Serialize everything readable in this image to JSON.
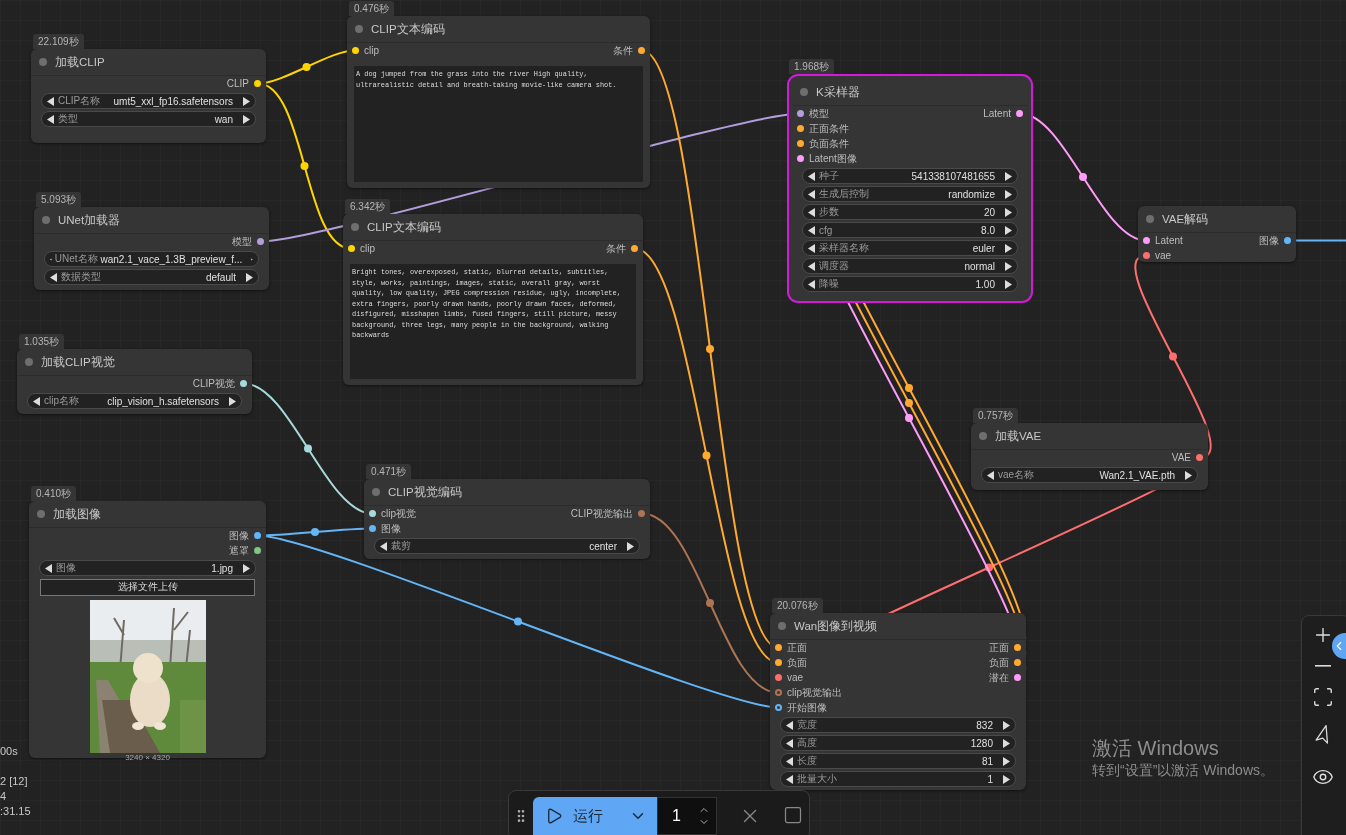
{
  "nodes": [
    {
      "title": "加载CLIP",
      "time": "22.109秒",
      "selected": false,
      "outputs": [
        {
          "label": "CLIP",
          "color": "#ffd500"
        }
      ],
      "widgets": [
        {
          "label": "CLIP名称",
          "value": "umt5_xxl_fp16.safetensors"
        },
        {
          "label": "类型",
          "value": "wan"
        }
      ]
    },
    {
      "title": "UNet加载器",
      "time": "5.093秒",
      "selected": false,
      "outputs": [
        {
          "label": "模型",
          "color": "#b39ddb"
        }
      ],
      "widgets": [
        {
          "label": "UNet名称",
          "value": "wan2.1_vace_1.3B_preview_f..."
        },
        {
          "label": "数据类型",
          "value": "default"
        }
      ]
    },
    {
      "title": "加载CLIP视觉",
      "time": "1.035秒",
      "selected": false,
      "outputs": [
        {
          "label": "CLIP视觉",
          "color": "#a8dadc"
        }
      ],
      "widgets": [
        {
          "label": "clip名称",
          "value": "clip_vision_h.safetensors"
        }
      ]
    },
    {
      "title": "加载图像",
      "time": "0.410秒",
      "selected": false,
      "outputs": [
        {
          "label": "图像",
          "color": "#64b5f6"
        },
        {
          "label": "遮罩",
          "color": "#81c784"
        }
      ],
      "widgets": [
        {
          "label": "图像",
          "value": "1.jpg"
        }
      ],
      "upload_button": "选择文件上传",
      "preview": {
        "kind": "picture",
        "size": "3240 × 4320"
      }
    },
    {
      "title": "CLIP文本编码",
      "time": "0.476秒",
      "selected": false,
      "inputs": [
        {
          "label": "clip",
          "color": "#ffd500"
        }
      ],
      "outputs": [
        {
          "label": "条件",
          "color": "#ffa931"
        }
      ],
      "prompt": "A dog jumped from the grass into the river  High quality, ultrarealistic detail and breath-taking movie-like camera shot."
    },
    {
      "title": "CLIP文本编码",
      "time": "6.342秒",
      "selected": false,
      "inputs": [
        {
          "label": "clip",
          "color": "#ffd500"
        }
      ],
      "outputs": [
        {
          "label": "条件",
          "color": "#ffa931"
        }
      ],
      "prompt": "Bright tones, overexposed, static, blurred details, subtitles, style, works, paintings, images, static, overall gray, worst quality, low quality, JPEG compression residue, ugly, incomplete, extra fingers, poorly drawn hands, poorly drawn faces, deformed, disfigured, misshapen limbs, fused fingers, still picture, messy background, three legs, many people in the background, walking backwards"
    },
    {
      "title": "CLIP视觉编码",
      "time": "0.471秒",
      "selected": false,
      "inputs": [
        {
          "label": "clip视觉",
          "color": "#a8dadc"
        },
        {
          "label": "图像",
          "color": "#64b5f6"
        }
      ],
      "outputs": [
        {
          "label": "CLIP视觉输出",
          "color": "#ad7452"
        }
      ],
      "widgets": [
        {
          "label": "裁剪",
          "value": "center"
        }
      ]
    },
    {
      "title": "K采样器",
      "time": "1.968秒",
      "selected": true,
      "inputs": [
        {
          "label": "模型",
          "color": "#b39ddb"
        },
        {
          "label": "正面条件",
          "color": "#ffa931"
        },
        {
          "label": "负面条件",
          "color": "#ffa931"
        },
        {
          "label": "Latent图像",
          "color": "#ff9cf9"
        }
      ],
      "outputs": [
        {
          "label": "Latent",
          "color": "#ff9cf9"
        }
      ],
      "widgets": [
        {
          "label": "种子",
          "value": "541338107481655"
        },
        {
          "label": "生成后控制",
          "value": "randomize"
        },
        {
          "label": "步数",
          "value": "20"
        },
        {
          "label": "cfg",
          "value": "8.0"
        },
        {
          "label": "采样器名称",
          "value": "euler"
        },
        {
          "label": "调度器",
          "value": "normal"
        },
        {
          "label": "降噪",
          "value": "1.00"
        }
      ]
    },
    {
      "title": "VAE解码",
      "selected": false,
      "inputs": [
        {
          "label": "Latent",
          "color": "#ff9cf9"
        },
        {
          "label": "vae",
          "color": "#ff6e6e"
        }
      ],
      "outputs": [
        {
          "label": "图像",
          "color": "#64b5f6"
        }
      ]
    },
    {
      "title": "加载VAE",
      "time": "0.757秒",
      "selected": false,
      "outputs": [
        {
          "label": "VAE",
          "color": "#ff6e6e"
        }
      ],
      "widgets": [
        {
          "label": "vae名称",
          "value": "Wan2.1_VAE.pth"
        }
      ]
    },
    {
      "title": "Wan图像到视频",
      "time": "20.076秒",
      "selected": false,
      "inputs": [
        {
          "label": "正面",
          "color": "#ffa931",
          "optional": false
        },
        {
          "label": "负面",
          "color": "#ffa931",
          "optional": false
        },
        {
          "label": "vae",
          "color": "#ff6e6e",
          "optional": false
        },
        {
          "label": "clip视觉输出",
          "color": "#ad7452",
          "optional": true
        },
        {
          "label": "开始图像",
          "color": "#64b5f6",
          "optional": true
        }
      ],
      "outputs": [
        {
          "label": "正面",
          "color": "#ffa931"
        },
        {
          "label": "负面",
          "color": "#ffa931"
        },
        {
          "label": "潜在",
          "color": "#ff9cf9"
        }
      ],
      "widgets": [
        {
          "label": "宽度",
          "value": "832"
        },
        {
          "label": "高度",
          "value": "1280"
        },
        {
          "label": "长度",
          "value": "81"
        },
        {
          "label": "批量大小",
          "value": "1"
        }
      ]
    }
  ],
  "stats": [
    "00s",
    "2 [12]",
    "4",
    ":31.15"
  ],
  "run_bar": {
    "run_label": "运行",
    "count": "1"
  },
  "os_notice": {
    "title": "激活 Windows",
    "subtitle": "转到“设置”以激活 Windows。"
  }
}
